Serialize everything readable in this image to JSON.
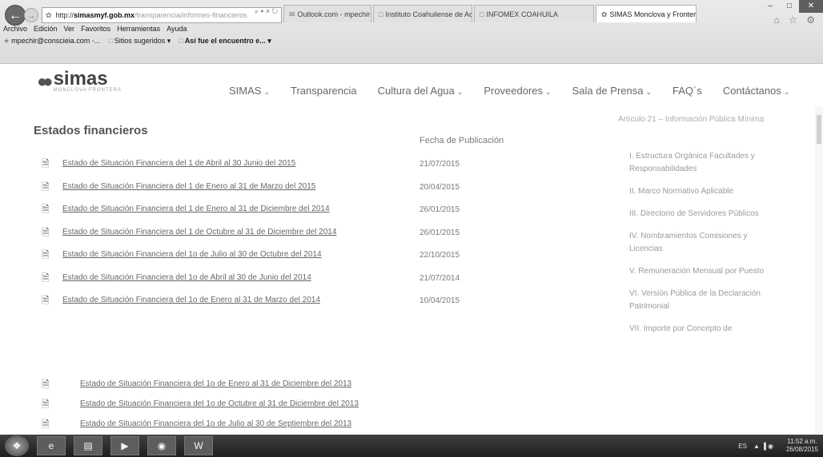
{
  "browser": {
    "address": {
      "scheme": "http://",
      "host": "simasmyf.gob.mx",
      "path": "/transparencia/informes-financieros",
      "controls": "⌕ ▾ × ↻"
    },
    "tabs": [
      {
        "label": "Outlook.com - mpechir@hot...",
        "active": false
      },
      {
        "label": "Instituto Coahuilense de Acce...",
        "active": false
      },
      {
        "label": "INFOMEX COAHUILA",
        "active": false
      },
      {
        "label": "SIMAS Monclova y Frontera...",
        "active": true
      }
    ],
    "tab_close": "×",
    "window_controls": {
      "minimize": "–",
      "maximize": "□",
      "close": "✕"
    },
    "toolbar_icons": "⌂ ☆ ⚙",
    "menu": [
      "Archivo",
      "Edición",
      "Ver",
      "Favoritos",
      "Herramientas",
      "Ayuda"
    ],
    "favorites": [
      {
        "label": "mpechir@conscieia.com -...",
        "bold": false
      },
      {
        "label": "Sitios sugeridos ▾",
        "bold": false
      },
      {
        "label": "Así fue el encuentro e... ▾",
        "bold": true
      }
    ]
  },
  "site": {
    "logo": {
      "name": "simas",
      "tagline": "MONCLOVA FRONTERA"
    },
    "nav": [
      {
        "label": "SIMAS",
        "dropdown": true
      },
      {
        "label": "Transparencia",
        "dropdown": false
      },
      {
        "label": "Cultura del Agua",
        "dropdown": true
      },
      {
        "label": "Proveedores",
        "dropdown": true
      },
      {
        "label": "Sala de Prensa",
        "dropdown": true
      },
      {
        "label": "FAQ´s",
        "dropdown": false
      },
      {
        "label": "Contáctanos",
        "dropdown": true
      }
    ]
  },
  "content": {
    "title": "Estados financieros",
    "date_column_header": "Fecha de Publicación",
    "documents": [
      {
        "title": "Estado de Situación Financiera del 1 de Abril al 30 Junio del 2015",
        "date": "21/07/2015"
      },
      {
        "title": "Estado de Situación Financiera del 1 de Enero al 31 de Marzo del 2015",
        "date": "20/04/2015"
      },
      {
        "title": "Estado de Situación Financiera del 1 de Enero al 31 de Diciembre del 2014",
        "date": "26/01/2015"
      },
      {
        "title": "Estado de Situación Financiera del 1 de Octubre al 31 de Diciembre del 2014",
        "date": "26/01/2015"
      },
      {
        "title": "Estado de Situación Financiera del 1o de Julio al 30 de Octubre del 2014",
        "date": "22/10/2015"
      },
      {
        "title": "Estado de Situación Financiera del 1o de Abril al 30 de Junio del 2014",
        "date": "21/07/2014"
      },
      {
        "title": "Estado de Situación Financiera del 1o de Enero al 31 de Marzo del 2014",
        "date": "10/04/2015"
      }
    ],
    "documents_older": [
      {
        "title": "Estado de Situación Financiera del 1o de Enero al 31 de Diciembre del 2013"
      },
      {
        "title": "Estado de Situación Financiera del 1o de Octubre al 31 de Diciembre del 2013"
      },
      {
        "title": "Estado de Situación Financiera del 1o de Julio al 30 de Septiembre del 2013"
      }
    ]
  },
  "sidebar": {
    "heading": "Artículo 21 – Información Pública Mínima",
    "items": [
      "I. Estructura Orgánica Facultades y Responsabilidades",
      "II. Marco Normativo Aplicable",
      "III. Directorio de Servidores Públicos",
      "IV. Nombramientos Comisiones y Licencias",
      "V. Remuneración Mensual por Puesto",
      "VI. Versión Pública de la Declaración Patrimonial",
      "VII. Importe por Concepto de"
    ]
  },
  "taskbar": {
    "start_icon": "start-orb",
    "apps": [
      "ie-icon",
      "folder-icon",
      "media-player-icon",
      "chrome-icon",
      "word-icon"
    ],
    "language": "ES",
    "tray_icons": "▲ ▐ ◉",
    "time": "11:52 a.m.",
    "date": "26/08/2015"
  }
}
